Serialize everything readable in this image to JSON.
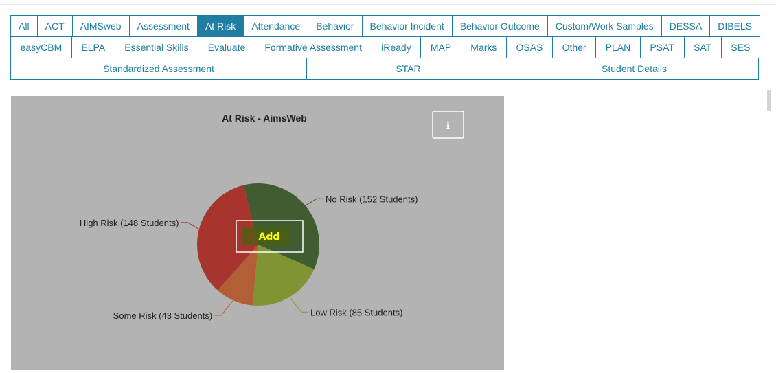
{
  "tabs": {
    "row1": [
      "All",
      "ACT",
      "AIMSweb",
      "Assessment",
      "At Risk",
      "Attendance",
      "Behavior",
      "Behavior Incident",
      "Behavior Outcome",
      "Custom/Work Samples",
      "DESSA",
      "DIBELS"
    ],
    "row2": [
      "easyCBM",
      "ELPA",
      "Essential Skills",
      "Evaluate",
      "Formative Assessment",
      "iReady",
      "MAP",
      "Marks",
      "OSAS",
      "Other",
      "PLAN",
      "PSAT",
      "SAT",
      "SES"
    ],
    "row3": [
      "Standardized Assessment",
      "STAR",
      "Student Details"
    ],
    "active": "At Risk"
  },
  "chart_data": {
    "type": "pie",
    "title": "At Risk - AimsWeb",
    "slices": [
      {
        "label": "No Risk (152 Students)",
        "value": 152,
        "color": "#415c30",
        "line_color": "#415c30"
      },
      {
        "label": "Low Risk (85 Students)",
        "value": 85,
        "color": "#809433",
        "line_color": "#809433"
      },
      {
        "label": "Some Risk (43 Students)",
        "value": 43,
        "color": "#b25f38",
        "line_color": "#c35a2a"
      },
      {
        "label": "High Risk (148 Students)",
        "value": 148,
        "color": "#a8352d",
        "line_color": "#a8352d"
      }
    ]
  },
  "info_button": {
    "icon": "info-icon",
    "glyph": "ℹ"
  },
  "add_button": {
    "label": "Add",
    "color": "#ffff00"
  }
}
